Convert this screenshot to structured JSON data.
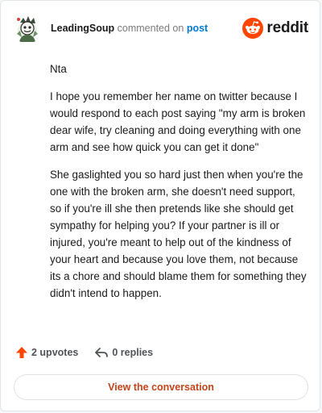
{
  "header": {
    "username": "LeadingSoup",
    "action": "commented on",
    "post_link": "post",
    "brand": "reddit"
  },
  "comment": {
    "paragraphs": [
      "Nta",
      "I hope you remember her name on twitter because I would respond to each post saying \"my arm is broken dear wife, try cleaning and doing everything with one arm and see how quick you can get it done\"",
      "She gaslighted you so hard just then when you're the one with the broken arm, she doesn't need support, so if you're ill she then pretends like she should get sympathy for helping you? If your partner is ill or injured, you're meant to help out of the kindness of your heart and because you love them, not because its a chore and should blame them for something they didn't intend to happen."
    ]
  },
  "actions": {
    "upvotes": "2 upvotes",
    "replies": "0 replies"
  },
  "footer": {
    "view_button": "View the conversation"
  },
  "colors": {
    "brand_orange": "#ff4500",
    "link_blue": "#0079d3",
    "button_text": "#c4441b"
  }
}
